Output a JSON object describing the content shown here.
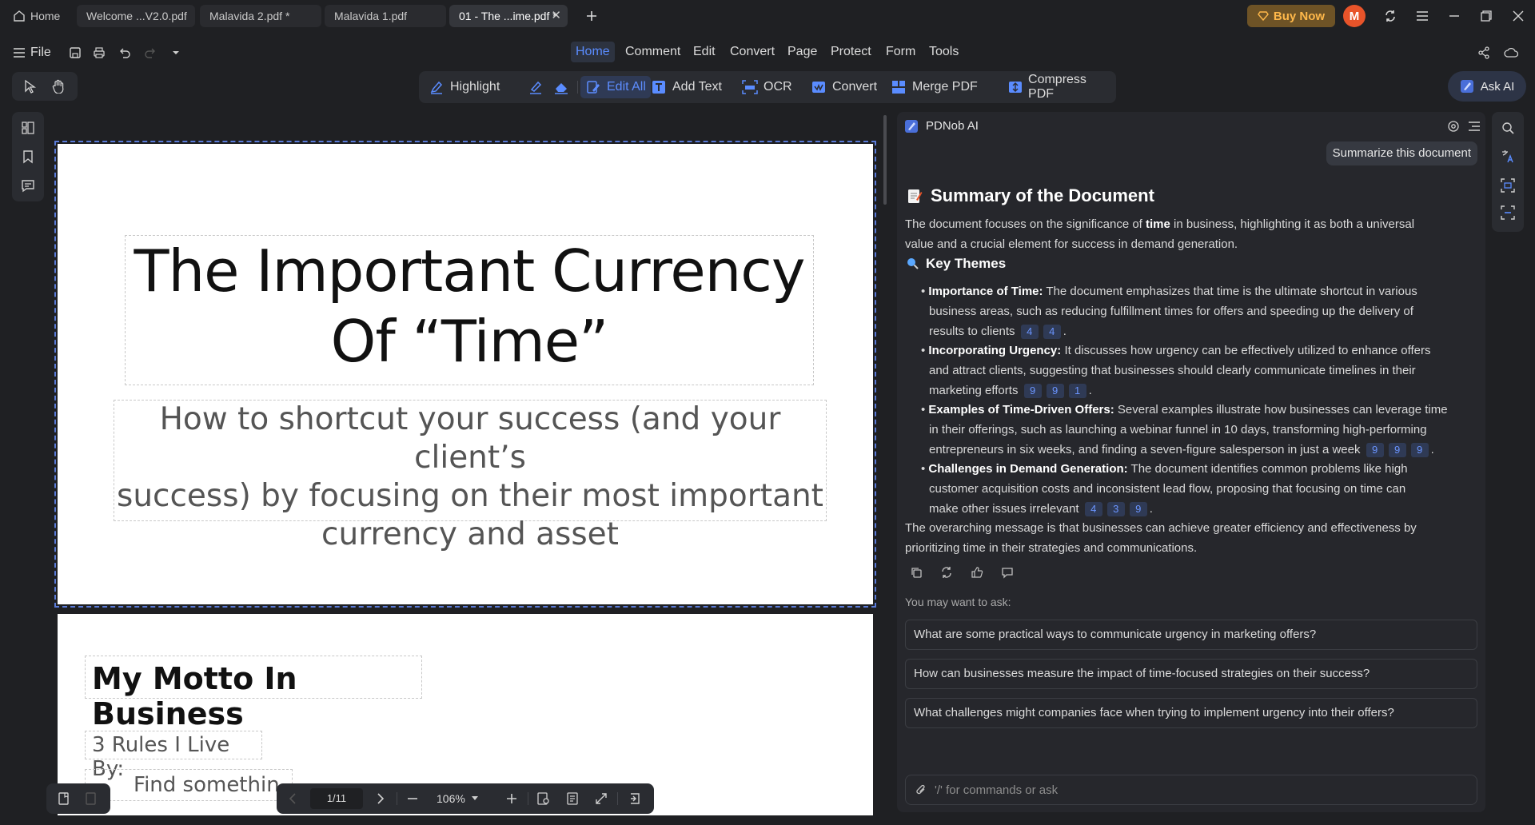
{
  "tabs": {
    "home": "Home",
    "items": [
      {
        "label": "Welcome ...V2.0.pdf"
      },
      {
        "label": "Malavida 2.pdf *"
      },
      {
        "label": "Malavida 1.pdf"
      },
      {
        "label": "01 - The ...ime.pdf *"
      }
    ]
  },
  "header": {
    "buy_now": "Buy Now",
    "avatar_initial": "M"
  },
  "menu": {
    "file": "File",
    "items": [
      "Home",
      "Comment",
      "Edit",
      "Convert",
      "Page",
      "Protect",
      "Form",
      "Tools"
    ],
    "active": "Home"
  },
  "toolbar": {
    "highlight": "Highlight",
    "edit_all": "Edit All",
    "add_text": "Add Text",
    "ocr": "OCR",
    "convert": "Convert",
    "merge_pdf": "Merge PDF",
    "compress_pdf": "Compress PDF",
    "ask_ai": "Ask AI"
  },
  "document": {
    "title_line1": "The Important Currency",
    "title_line2": "Of “Time”",
    "subtitle_line1": "How to shortcut your success (and your client’s",
    "subtitle_line2": "success) by focusing on their most important",
    "subtitle_line3": "currency and asset",
    "page2_heading": "My Motto In Business",
    "page2_rules": "3 Rules I Live By:",
    "page2_partial": "Find somethin"
  },
  "pager": {
    "page": "1/11",
    "zoom": "106%"
  },
  "ai": {
    "panel_title": "PDNob AI",
    "user_prompt": "Summarize this document",
    "summary_heading": "Summary of the Document",
    "intro_pre": "The document focuses on the significance of ",
    "intro_bold": "time",
    "intro_post": " in business, highlighting it as both a universal",
    "intro_line2": "value and a crucial element for success in demand generation.",
    "themes_heading": "Key Themes",
    "themes": [
      {
        "title": "Importance of Time:",
        "line1": " The document emphasizes that time is the ultimate shortcut in various",
        "line2": "business areas, such as reducing fulfillment times for offers and speeding up the delivery of",
        "line3": "results to clients",
        "refs": [
          "4",
          "4"
        ]
      },
      {
        "title": "Incorporating Urgency:",
        "line1": " It discusses how urgency can be effectively utilized to enhance offers",
        "line2": "and attract clients, suggesting that businesses should clearly communicate timelines in their",
        "line3": "marketing efforts",
        "refs": [
          "9",
          "9",
          "1"
        ]
      },
      {
        "title": "Examples of Time-Driven Offers:",
        "line1": " Several examples illustrate how businesses can leverage time",
        "line2": "in their offerings, such as launching a webinar funnel in 10 days, transforming high-performing",
        "line3": "entrepreneurs in six weeks, and finding a seven-figure salesperson in just a week",
        "refs": [
          "9",
          "9",
          "9"
        ]
      },
      {
        "title": "Challenges in Demand Generation:",
        "line1": " The document identifies common problems like high",
        "line2": "customer acquisition costs and inconsistent lead flow, proposing that focusing on time can",
        "line3": "make other issues irrelevant",
        "refs": [
          "4",
          "3",
          "9"
        ]
      }
    ],
    "conclusion_line1": "The overarching message is that businesses can achieve greater efficiency and effectiveness by",
    "conclusion_line2": "prioritizing time in their strategies and communications.",
    "may_ask": "You may want to ask:",
    "suggestions": [
      "What are some practical ways to communicate urgency in marketing offers?",
      "How can businesses measure the impact of time-focused strategies on their success?",
      "What challenges might companies face when trying to implement urgency into their offers?"
    ],
    "input_placeholder": "'/' for commands or ask"
  },
  "colors": {
    "accent": "#5a8cff",
    "buy_now_bg": "#6e5326",
    "buy_now_text": "#ffb84a",
    "avatar": "#e8542a"
  }
}
